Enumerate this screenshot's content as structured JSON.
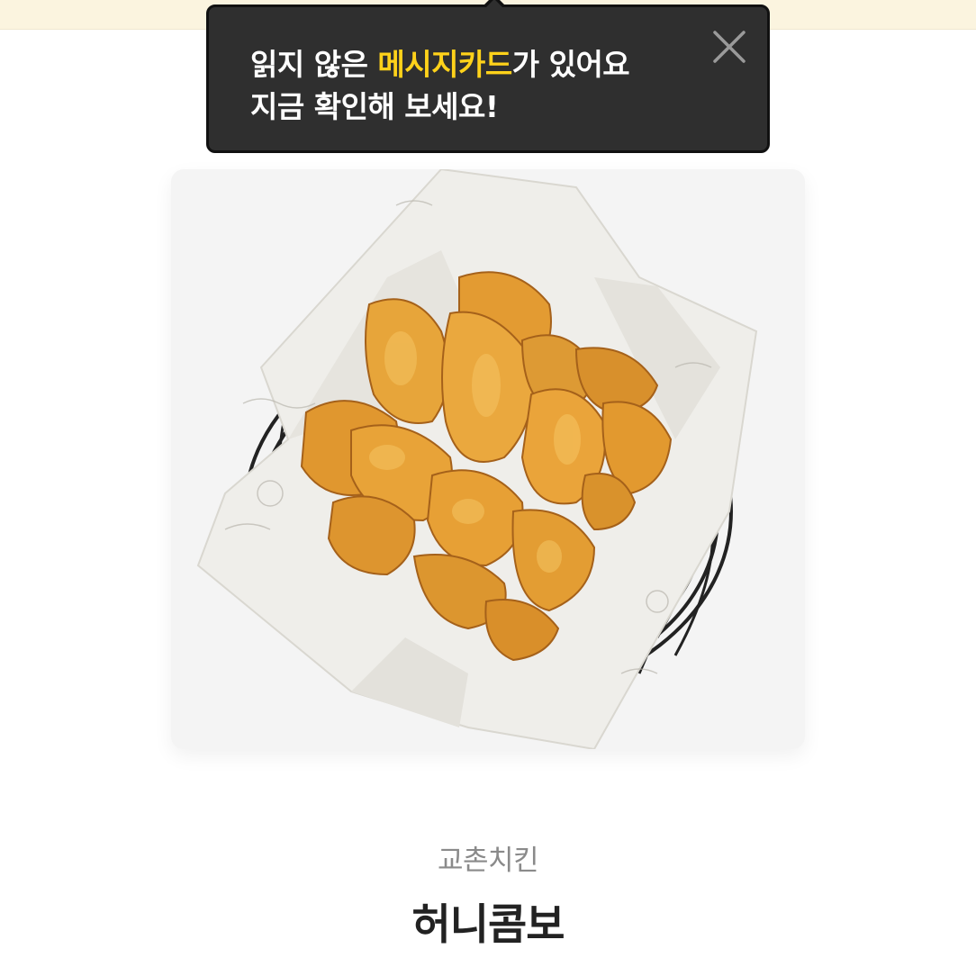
{
  "tooltip": {
    "line1_before": "읽지 않은 ",
    "line1_highlight": "메시지카드",
    "line1_after": "가 있어요",
    "line2": "지금 확인해 보세요!",
    "highlight_color": "#ffd21a",
    "close_icon": "close-icon"
  },
  "product": {
    "brand": "교촌치킨",
    "name": "허니콤보",
    "image_icon": "fried-chicken-basket-image"
  },
  "colors": {
    "top_strip": "#fbf4df",
    "tooltip_bg": "#2f2f2f",
    "card_bg": "#f4f4f4"
  }
}
